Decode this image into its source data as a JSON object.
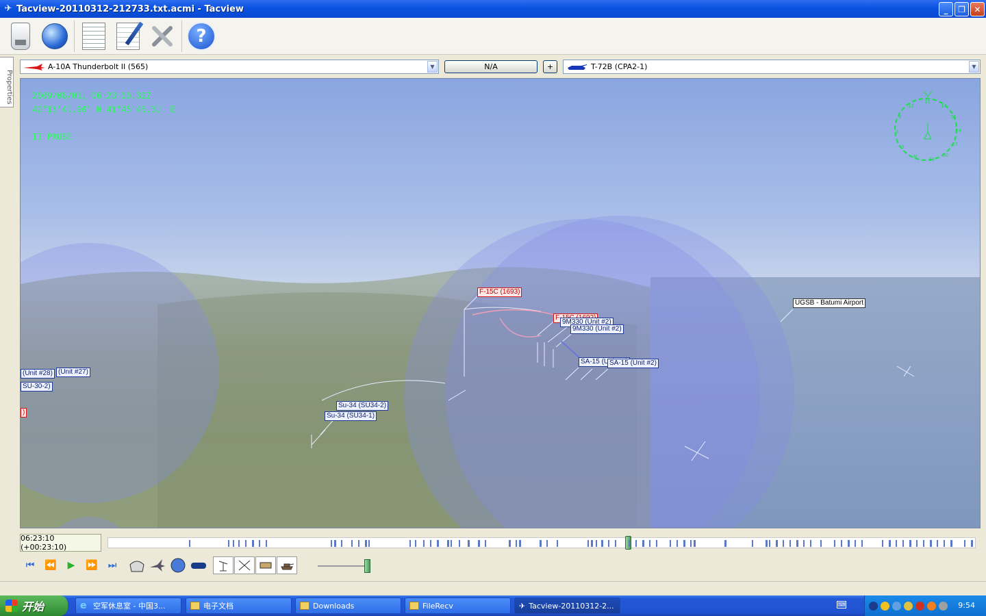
{
  "window": {
    "title": "Tacview-20110312-212733.txt.acmi - Tacview",
    "minimize": "_",
    "restore": "❐",
    "close": "✕"
  },
  "toolbar": {
    "icons": [
      "usb-drive-icon",
      "globe-icon",
      "document-icon",
      "notepad-pen-icon",
      "tools-icon",
      "help-icon"
    ],
    "help_glyph": "?"
  },
  "sidetab": {
    "label": "Properties"
  },
  "selection": {
    "primary_object": "A-10A Thunderbolt II (565)",
    "relation": "N/A",
    "add_label": "+",
    "secondary_object": "T-72B (CPA2-1)"
  },
  "hud": {
    "datetime": "2009/06/01, 06:23:10.32Z",
    "coordinates": "42°15'41.90\" N  41°45'45.31\" E",
    "state": "II PAUSE"
  },
  "compass": {
    "ticks": [
      "15",
      "18",
      "21",
      "24",
      "27",
      "30",
      "33",
      "N",
      "3",
      "6",
      "9",
      "12"
    ]
  },
  "labels": [
    {
      "text": "F-15C (1693)",
      "style": "red"
    },
    {
      "text": "F-15C (1692)",
      "style": "red"
    },
    {
      "text": "9M330 (Unit #2)",
      "style": "blue"
    },
    {
      "text": "9M330 (Unit #2)",
      "style": "blue"
    },
    {
      "text": "SA-15 (Unit #1)",
      "style": "blue"
    },
    {
      "text": "SA-15 (Unit #2)",
      "style": "blue"
    },
    {
      "text": "UGSB - Batumi Airport",
      "style": "white"
    },
    {
      "text": "(Unit #28)",
      "style": "blue"
    },
    {
      "text": "(Unit #27)",
      "style": "blue"
    },
    {
      "text": "SU-30-2)",
      "style": "blue"
    },
    {
      "text": ")",
      "style": "red"
    },
    {
      "text": "Su-34 (SU34-2)",
      "style": "blue"
    },
    {
      "text": "Su-34 (SU34-1)",
      "style": "blue"
    }
  ],
  "timeline": {
    "current": "06:23:10 (+00:23:10)",
    "position_fraction": 0.6
  },
  "playback": {
    "first": "⏮",
    "rewind": "⏪",
    "play": "▶",
    "forward": "⏩",
    "last": "⏭",
    "speed_fraction": 0.95
  },
  "view_buttons": [
    "cockpit-view-icon",
    "aircraft-icon",
    "globe-view-icon",
    "binoculars-icon",
    "radar-icon",
    "satellite-icon",
    "truck-icon",
    "tank-icon"
  ],
  "taskbar": {
    "start": "开始",
    "tasks": [
      {
        "label": "空军休息室 - 中国3...",
        "icon": "ie"
      },
      {
        "label": "电子文档",
        "icon": "folder"
      },
      {
        "label": "Downloads",
        "icon": "folder"
      },
      {
        "label": "FileRecv",
        "icon": "folder"
      },
      {
        "label": "Tacview-20110312-2...",
        "icon": "tacview",
        "active": true
      }
    ],
    "clock": "9:54",
    "kbd": "⌨"
  },
  "colors": {
    "hud_green": "#2aff5a",
    "title_blue": "#0a52e0",
    "dome": "#8c8ce6"
  }
}
